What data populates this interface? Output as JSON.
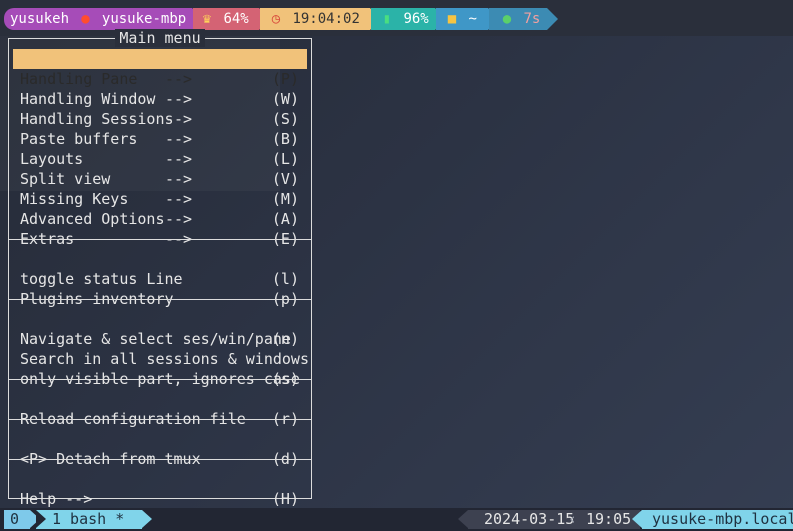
{
  "status_top": {
    "user": "yusukeh",
    "host": "yusuke-mbp",
    "mood_percent": "64%",
    "time": "19:04:02",
    "battery": "96%",
    "directory": "~",
    "duration": "7s",
    "icons": [
      "apple-icon",
      "crown-icon",
      "clock-icon",
      "battery-icon",
      "folder-icon",
      "turtle-icon"
    ]
  },
  "menu": {
    "title": "Main menu",
    "group1": [
      {
        "label": "Handling Pane",
        "arrow": "-->",
        "key": "(P)",
        "selected": true
      },
      {
        "label": "Handling Window",
        "arrow": "-->",
        "key": "(W)"
      },
      {
        "label": "Handling Sessions",
        "arrow": "-->",
        "key": "(S)"
      },
      {
        "label": "Paste buffers",
        "arrow": "-->",
        "key": "(B)"
      },
      {
        "label": "Layouts",
        "arrow": "-->",
        "key": "(L)"
      },
      {
        "label": "Split view",
        "arrow": "-->",
        "key": "(V)"
      },
      {
        "label": "Missing Keys",
        "arrow": "-->",
        "key": "(M)"
      },
      {
        "label": "Advanced Options",
        "arrow": "-->",
        "key": "(A)"
      },
      {
        "label": "Extras",
        "arrow": "-->",
        "key": "(E)"
      }
    ],
    "group2": [
      {
        "label": "toggle status Line",
        "key": "(l)"
      },
      {
        "label": "Plugins inventory",
        "key": "(p)"
      }
    ],
    "group3": [
      {
        "label": "Navigate & select ses/win/pane",
        "key": "(n)"
      },
      {
        "label": "Search in all sessions & windows",
        "key": ""
      },
      {
        "label": "only visible part, ignores case",
        "key": "(s)"
      }
    ],
    "group4": [
      {
        "label": "Reload configuration file",
        "key": "(r)"
      }
    ],
    "group5": [
      {
        "label": "<P> Detach from tmux",
        "key": "(d)"
      }
    ],
    "group6": [
      {
        "label": "Help -->",
        "key": "(H)"
      }
    ]
  },
  "status_bottom": {
    "session": "0",
    "window": "1 bash *",
    "date": "2024-03-15",
    "time": "19:05",
    "hostname": "yusuke-mbp.local"
  },
  "colors": {
    "selected_bg": "#f1c27a",
    "user_segment": "#a64cb8",
    "mood_segment": "#d46374",
    "time_segment": "#f1c27a",
    "battery_segment": "#2bb3a8",
    "dir_segment": "#3f97c7",
    "window_tab": "#80d4ea"
  }
}
